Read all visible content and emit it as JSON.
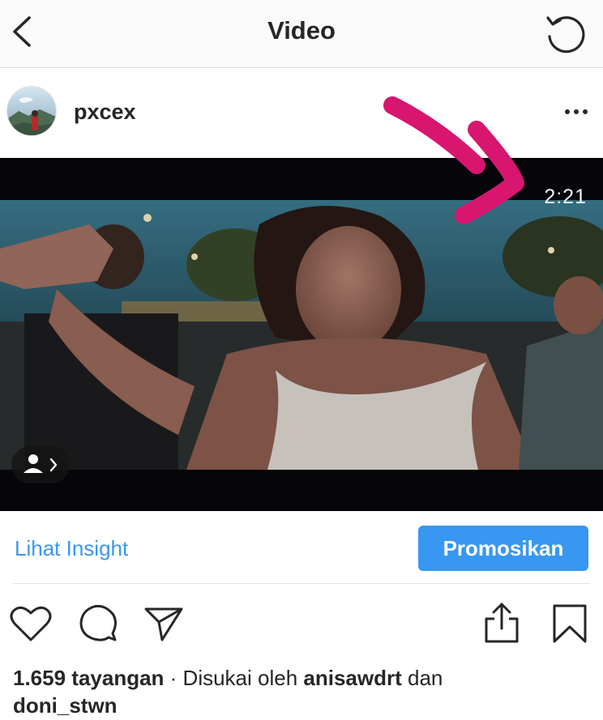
{
  "nav": {
    "title": "Video",
    "back_icon": "chevron-left-icon",
    "refresh_icon": "refresh-icon"
  },
  "post": {
    "username": "pxcex",
    "more_icon": "more-horizontal-icon",
    "video_duration": "2:21",
    "tag_icon": "user-tag-icon"
  },
  "insight": {
    "insight_label": "Lihat Insight",
    "promote_label": "Promosikan"
  },
  "actions": {
    "like_icon": "heart-icon",
    "comment_icon": "comment-icon",
    "share_icon": "send-icon",
    "upload_icon": "share-upload-icon",
    "save_icon": "bookmark-icon"
  },
  "stats": {
    "views": "1.659 tayangan",
    "separator": " · ",
    "liked_prefix": "Disukai oleh ",
    "liker_one": "anisawdrt",
    "conjunction": " dan",
    "liker_two": "doni_stwn"
  },
  "colors": {
    "accent": "#3897f0",
    "annotation": "#d8156f",
    "text": "#262626"
  }
}
